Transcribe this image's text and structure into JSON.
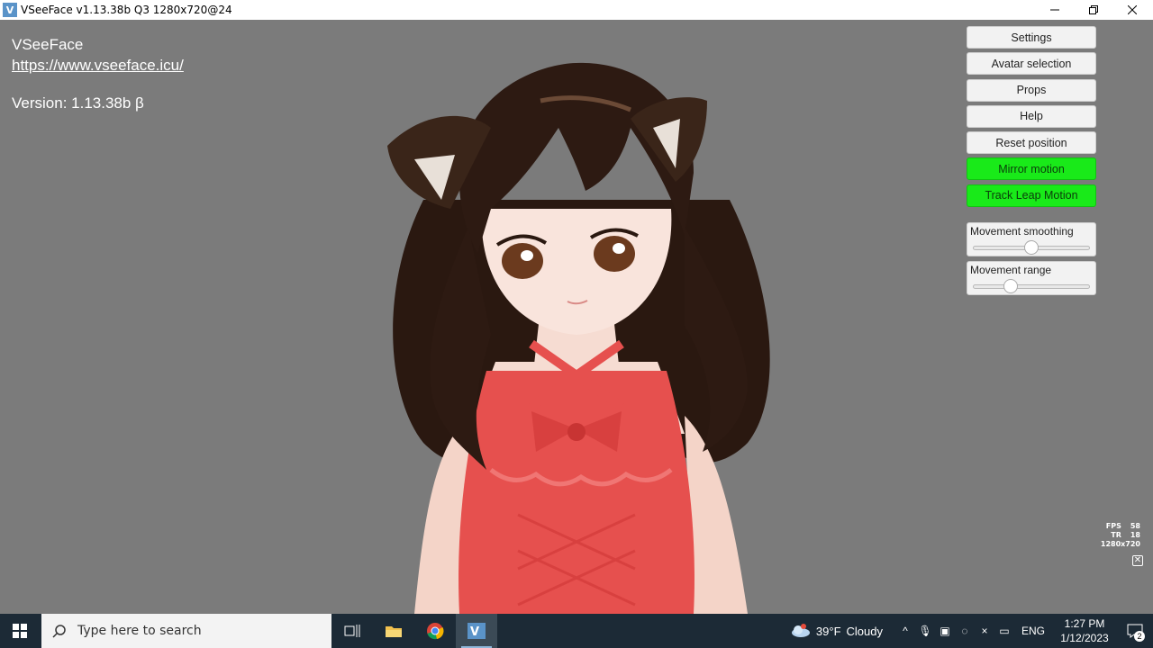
{
  "window": {
    "icon_label": "V",
    "title": "VSeeFace v1.13.38b Q3 1280x720@24",
    "minimize": "—",
    "maximize": "❐",
    "close": "✕"
  },
  "info": {
    "app_name": "VSeeFace",
    "url": "https://www.vseeface.icu/",
    "version": "Version: 1.13.38b β"
  },
  "panel": {
    "buttons": [
      {
        "label": "Settings",
        "active": false
      },
      {
        "label": "Avatar selection",
        "active": false
      },
      {
        "label": "Props",
        "active": false
      },
      {
        "label": "Help",
        "active": false
      },
      {
        "label": "Reset position",
        "active": false
      },
      {
        "label": "Mirror motion",
        "active": true
      },
      {
        "label": "Track Leap Motion",
        "active": true
      }
    ],
    "sliders": [
      {
        "label": "Movement smoothing",
        "value": 0.5
      },
      {
        "label": "Movement range",
        "value": 0.32
      }
    ],
    "active_color": "#19ea19"
  },
  "stats": {
    "fps_label": "FPS",
    "fps_value": "58",
    "tr_label": "TR",
    "tr_value": "18",
    "resolution": "1280x720",
    "corner_icon": "close-box-icon"
  },
  "taskbar": {
    "search_placeholder": "Type here to search",
    "apps": [
      "task-view-icon",
      "file-explorer-icon",
      "chrome-icon",
      "vseeface-icon"
    ],
    "weather_temp": "39°F",
    "weather_desc": "Cloudy",
    "language": "ENG",
    "time": "1:27 PM",
    "date": "1/12/2023",
    "notification_count": "2"
  }
}
